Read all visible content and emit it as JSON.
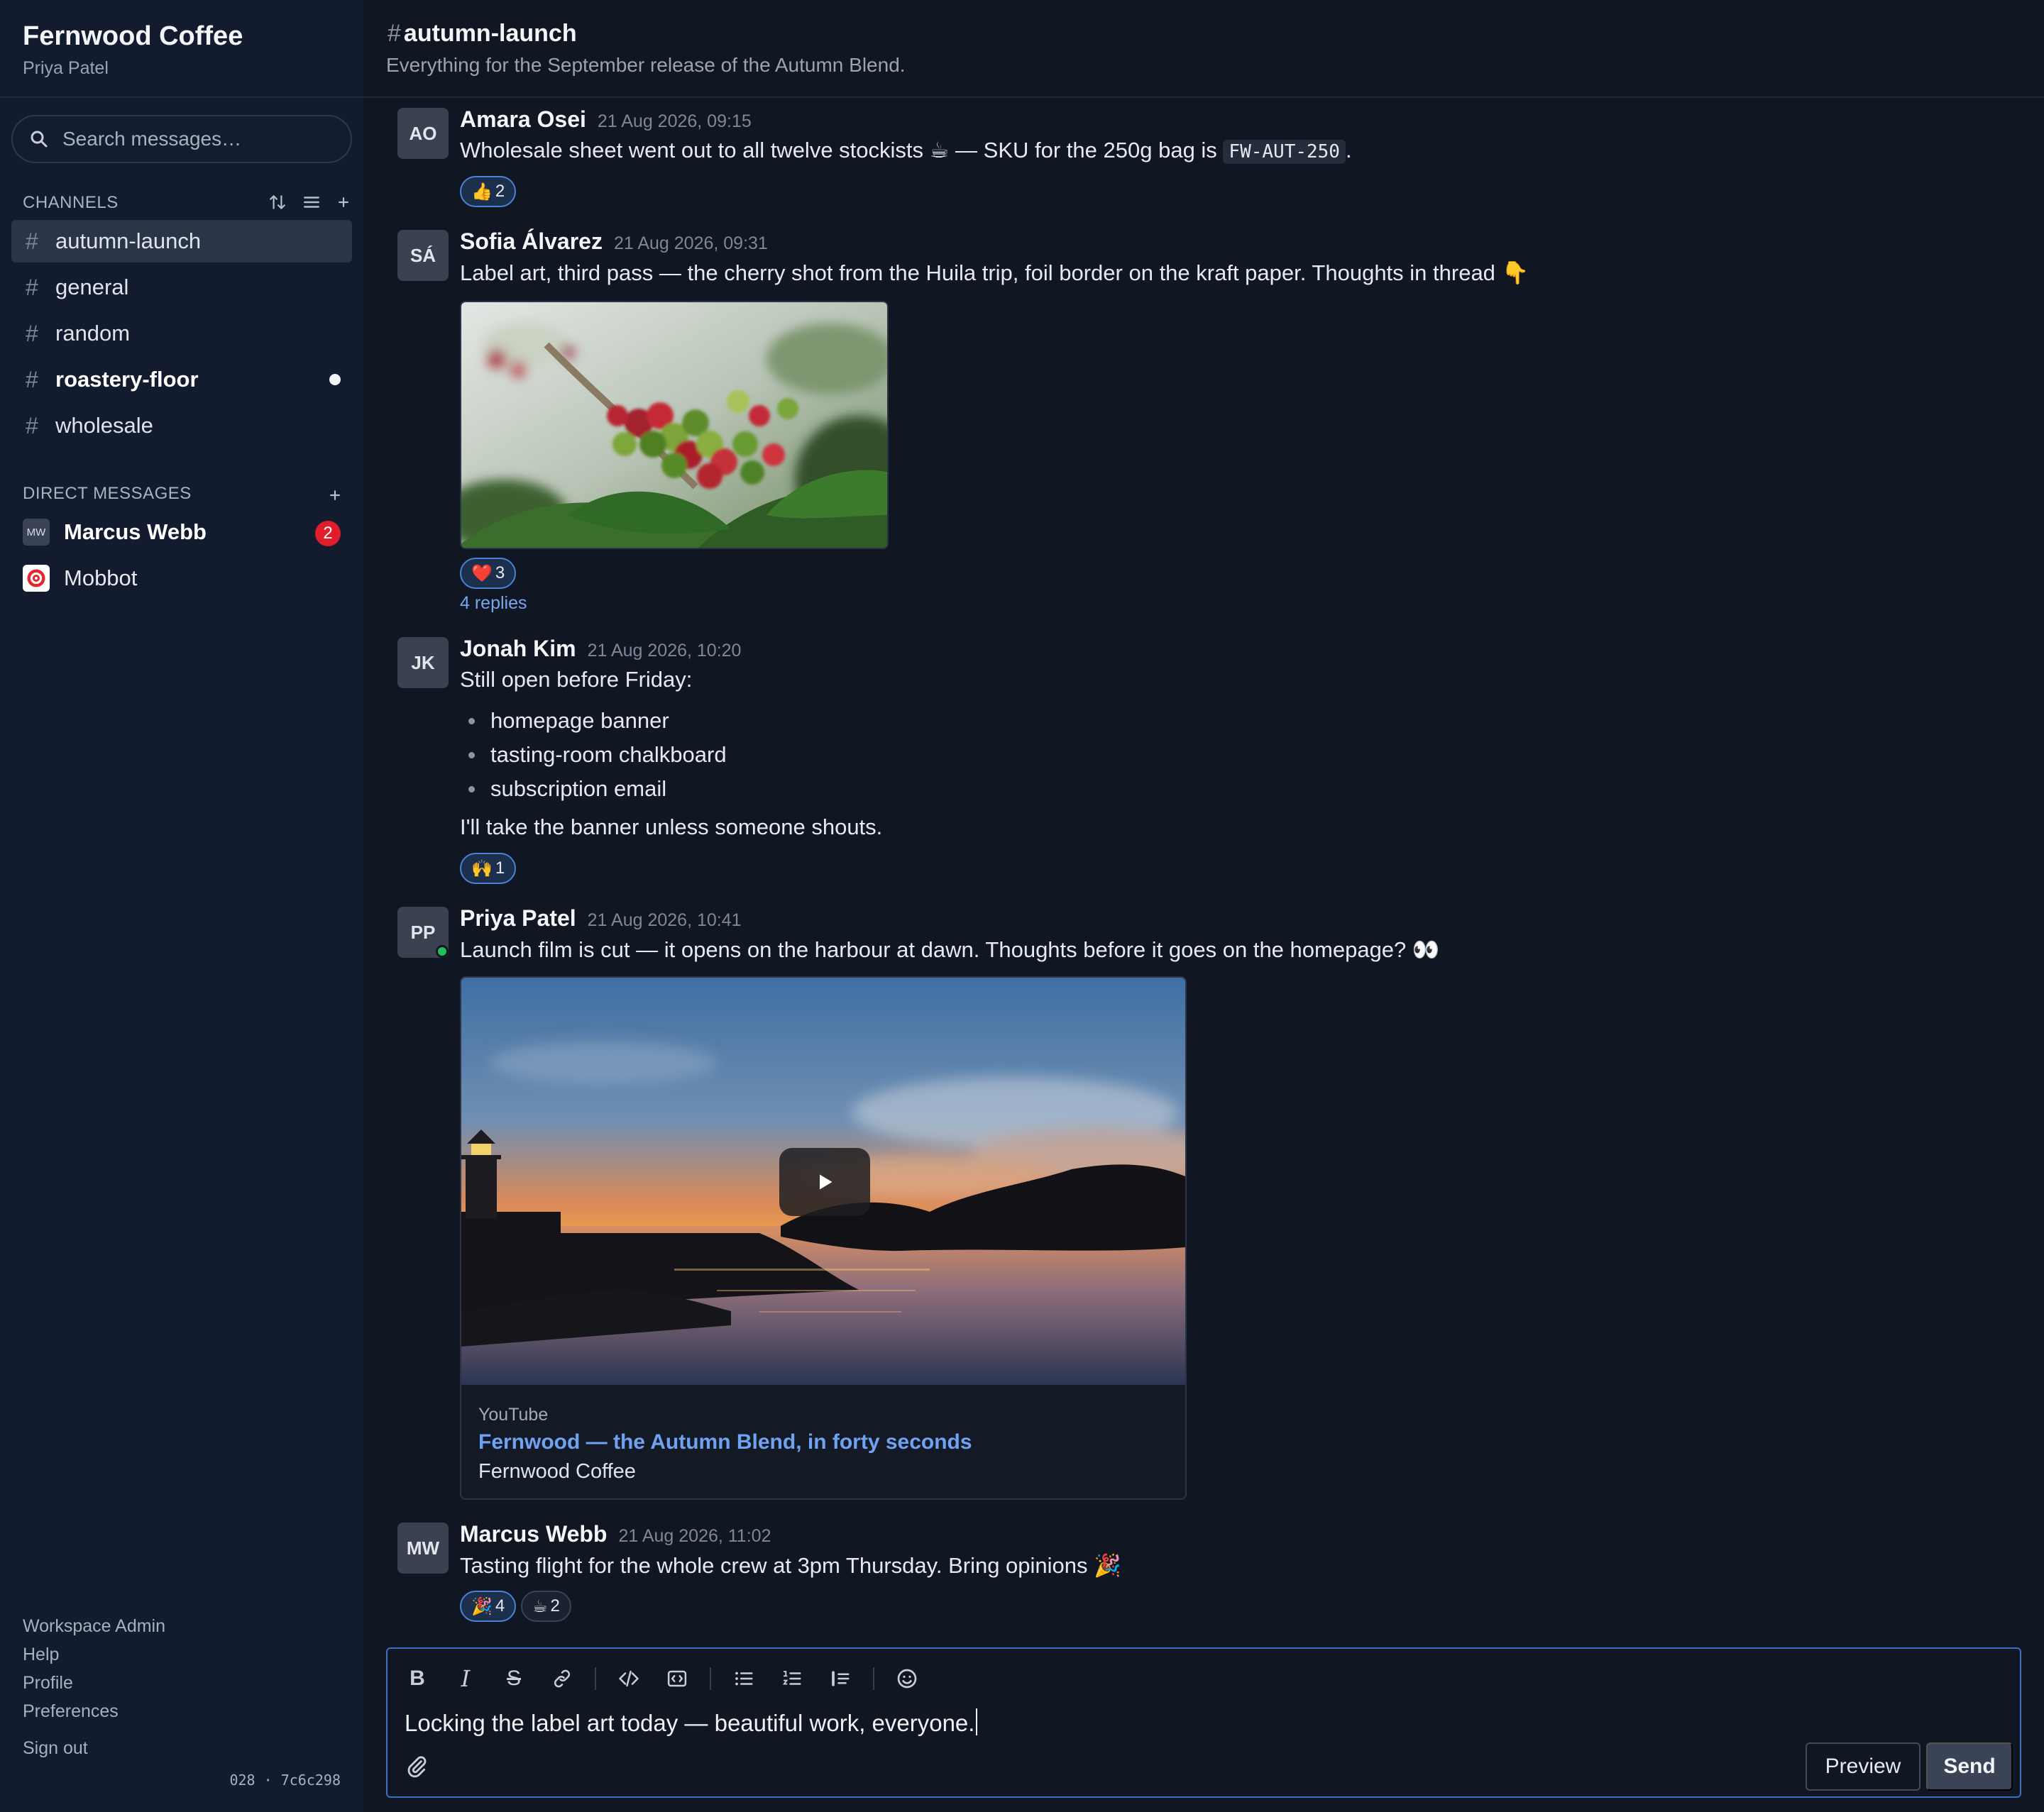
{
  "workspace": {
    "name": "Fernwood Coffee",
    "user": "Priya Patel"
  },
  "search": {
    "placeholder": "Search messages…"
  },
  "channels_section": {
    "title": "CHANNELS",
    "items": [
      {
        "name": "autumn-launch",
        "active": true,
        "unread": false
      },
      {
        "name": "general",
        "active": false,
        "unread": false
      },
      {
        "name": "random",
        "active": false,
        "unread": false
      },
      {
        "name": "roastery-floor",
        "active": false,
        "unread": true
      },
      {
        "name": "wholesale",
        "active": false,
        "unread": false
      }
    ]
  },
  "dm_section": {
    "title": "DIRECT MESSAGES",
    "items": [
      {
        "initials": "MW",
        "name": "Marcus Webb",
        "badge": "2"
      },
      {
        "initials": "",
        "name": "Mobbot",
        "badge": ""
      }
    ]
  },
  "footer_links": [
    "Workspace Admin",
    "Help",
    "Profile",
    "Preferences",
    "Sign out"
  ],
  "build_info": "028 · 7c6c298",
  "channel_header": {
    "hash": "#",
    "name": "autumn-launch",
    "description": "Everything for the September release of the Autumn Blend."
  },
  "messages": [
    {
      "initials": "AO",
      "author": "Amara Osei",
      "timestamp": "21 Aug 2026, 09:15",
      "text_before": "Wholesale sheet went out to all twelve stockists ☕ — SKU for the 250g bag is ",
      "code": "FW-AUT-250",
      "text_after": ".",
      "reactions": [
        {
          "emoji": "👍",
          "count": "2"
        }
      ]
    },
    {
      "initials": "SÁ",
      "author": "Sofia Álvarez",
      "timestamp": "21 Aug 2026, 09:31",
      "text": "Label art, third pass — the cherry shot from the Huila trip, foil border on the kraft paper. Thoughts in thread 👇",
      "reactions": [
        {
          "emoji": "❤️",
          "count": "3"
        }
      ],
      "replies": "4 replies"
    },
    {
      "initials": "JK",
      "author": "Jonah Kim",
      "timestamp": "21 Aug 2026, 10:20",
      "text": "Still open before Friday:",
      "bullets": [
        "homepage banner",
        "tasting-room chalkboard",
        "subscription email"
      ],
      "text_after": "I'll take the banner unless someone shouts.",
      "reactions": [
        {
          "emoji": "🙌",
          "count": "1"
        }
      ]
    },
    {
      "initials": "PP",
      "author": "Priya Patel",
      "timestamp": "21 Aug 2026, 10:41",
      "text": "Launch film is cut — it opens on the harbour at dawn. Thoughts before it goes on the homepage? 👀",
      "embed": {
        "provider": "YouTube",
        "title": "Fernwood — the Autumn Blend, in forty seconds",
        "author": "Fernwood Coffee"
      }
    },
    {
      "initials": "MW",
      "author": "Marcus Webb",
      "timestamp": "21 Aug 2026, 11:02",
      "text": "Tasting flight for the whole crew at 3pm Thursday. Bring opinions 🎉",
      "reactions": [
        {
          "emoji": "🎉",
          "count": "4"
        },
        {
          "emoji": "☕",
          "count": "2"
        }
      ]
    }
  ],
  "composer": {
    "text": "Locking the label art today — beautiful work, everyone.",
    "preview_label": "Preview",
    "send_label": "Send"
  },
  "colors": {
    "sidebar_bg": "#131c2f",
    "main_bg": "#111722",
    "accent": "#3d6fc4",
    "link": "#6fa3f2",
    "badge": "#e01e2b",
    "presence": "#1fc05a"
  }
}
